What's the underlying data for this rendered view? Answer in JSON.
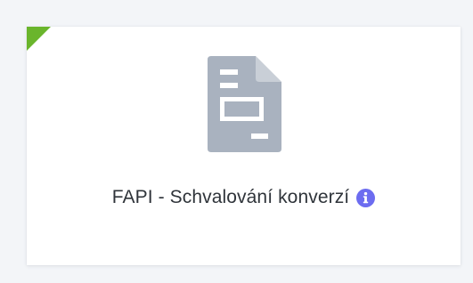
{
  "card": {
    "title": "FAPI - Schvalování konverzí",
    "status_color": "#6ab52c",
    "icon": "document-icon",
    "info_icon": "info-icon",
    "info_color": "#6c6cf0"
  }
}
